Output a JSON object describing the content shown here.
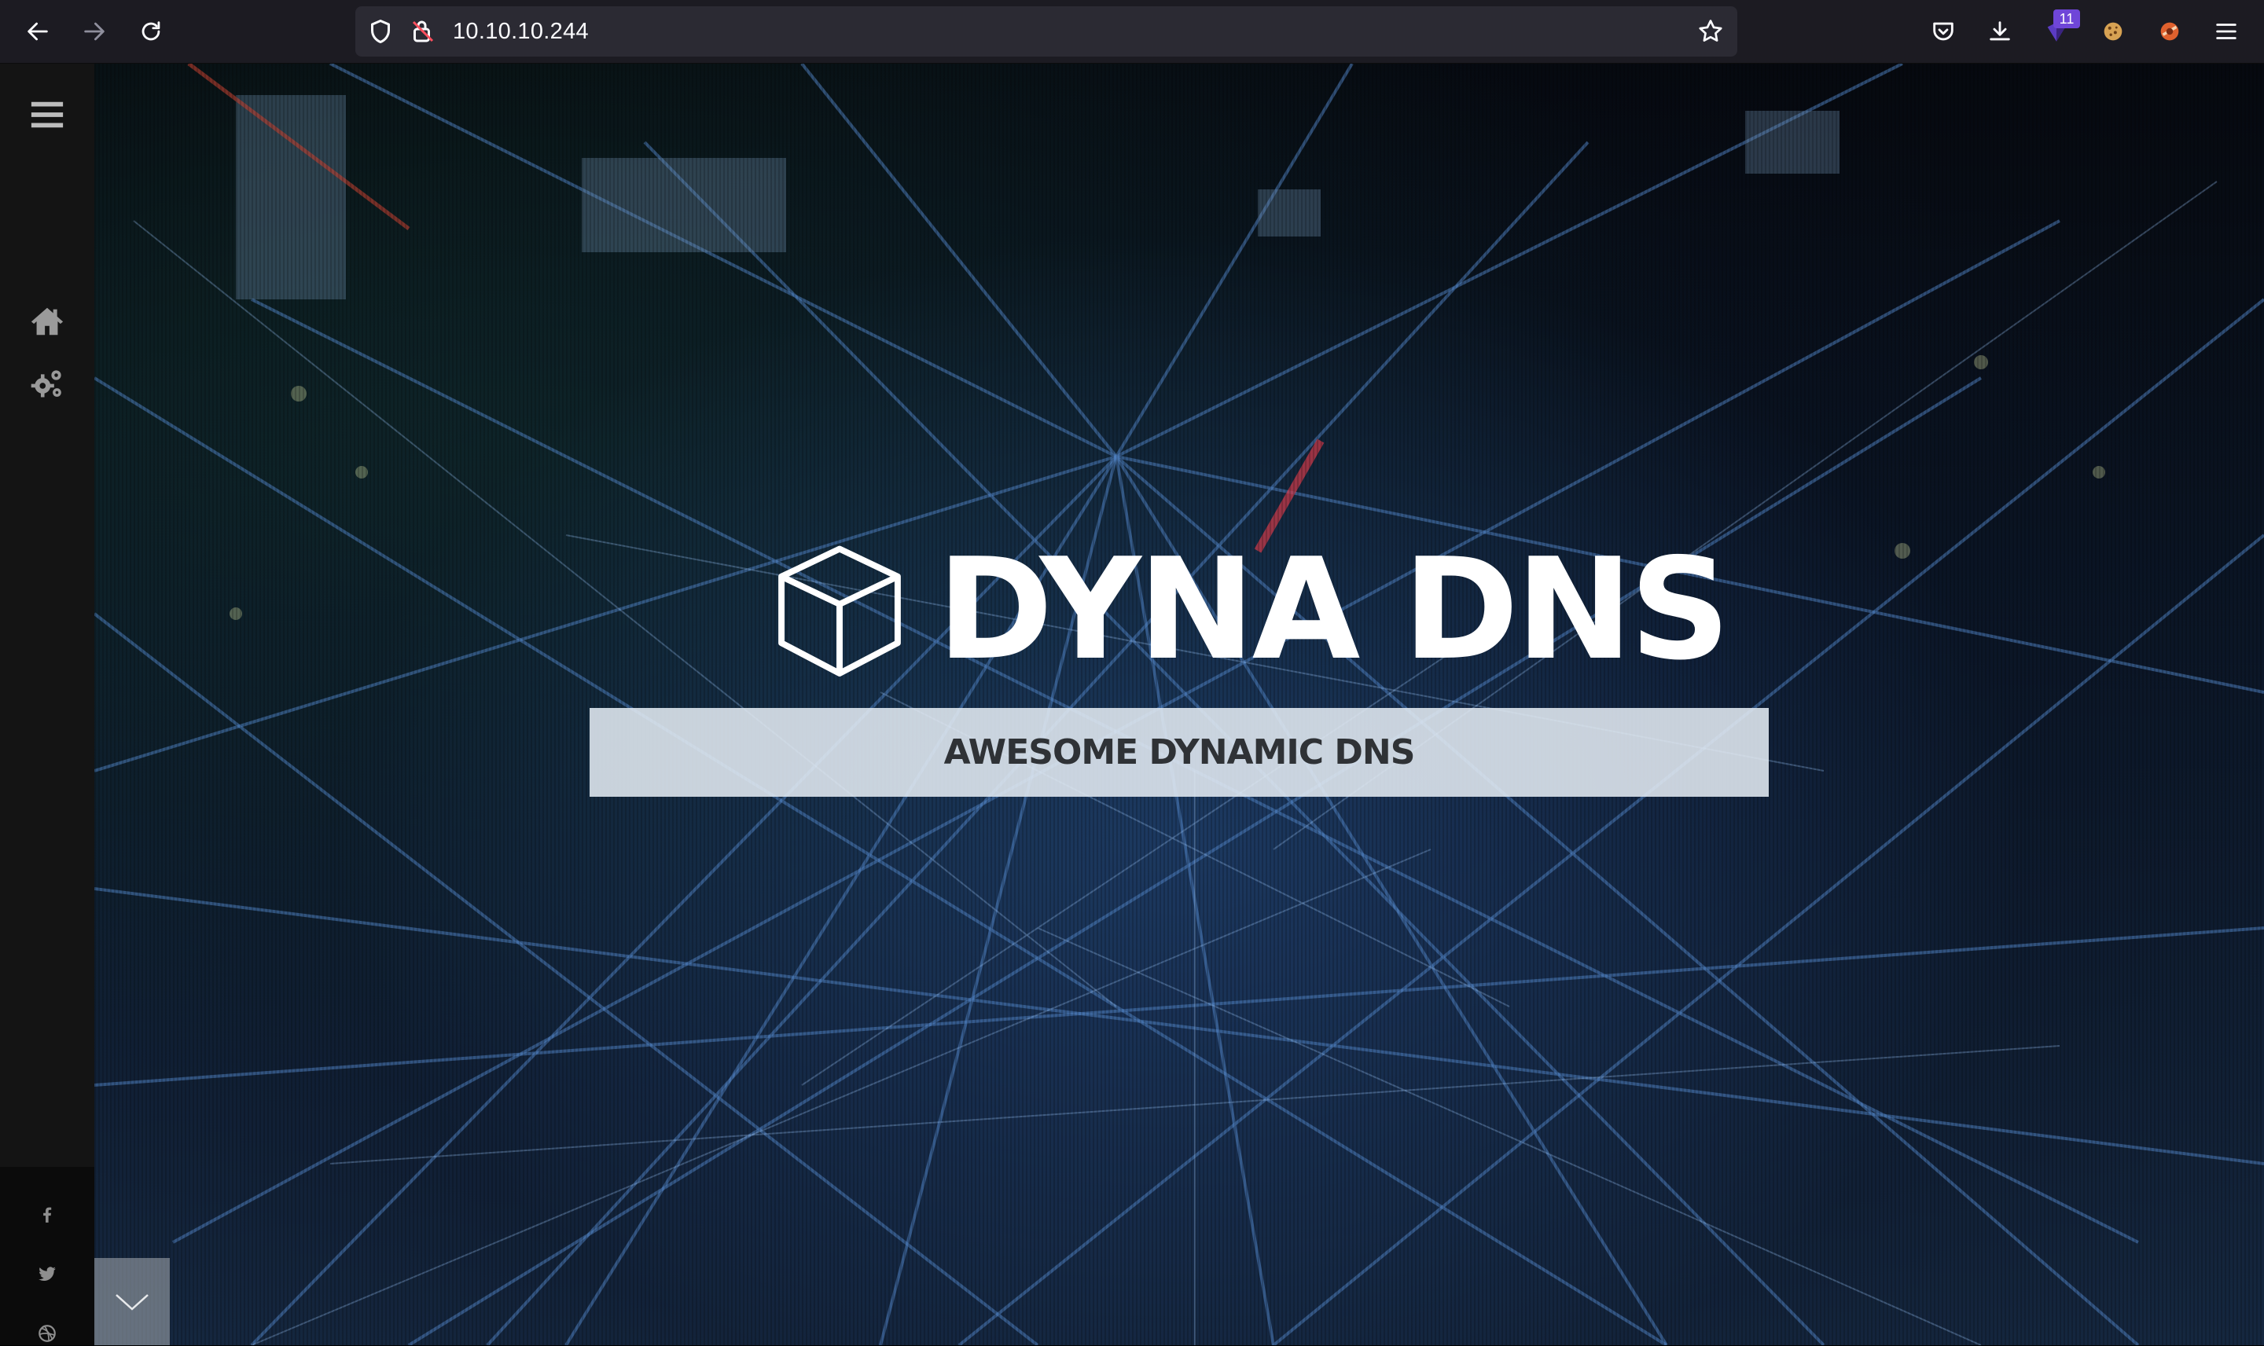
{
  "browser": {
    "url": "10.10.10.244",
    "extension_badge": "11",
    "icons": {
      "back": "arrow-left-icon",
      "forward": "arrow-right-icon",
      "reload": "reload-icon",
      "tracking": "shield-icon",
      "insecure": "lock-warning-icon",
      "bookmark": "star-icon",
      "pocket": "pocket-icon",
      "downloads": "download-icon",
      "menu": "hamburger-icon"
    }
  },
  "sidebar": {
    "menu_icon": "hamburger-icon",
    "items": [
      {
        "name": "home",
        "icon": "home-icon"
      },
      {
        "name": "services",
        "icon": "gears-icon"
      }
    ],
    "social": [
      {
        "name": "facebook",
        "icon": "facebook-icon"
      },
      {
        "name": "twitter",
        "icon": "twitter-icon"
      },
      {
        "name": "dribbble",
        "icon": "dribbble-icon"
      }
    ]
  },
  "hero": {
    "title": "DYNA DNS",
    "tagline": "AWESOME DYNAMIC DNS",
    "logo_icon": "cube-icon",
    "scroll_icon": "chevron-down-icon"
  },
  "colors": {
    "toolbar_bg": "#1c1b22",
    "urlbar_bg": "#2b2a33",
    "sidebar_bg": "#141414",
    "tagline_bg": "#e2eaf2",
    "tagline_text": "#2f3236",
    "title_text": "#ffffff"
  }
}
